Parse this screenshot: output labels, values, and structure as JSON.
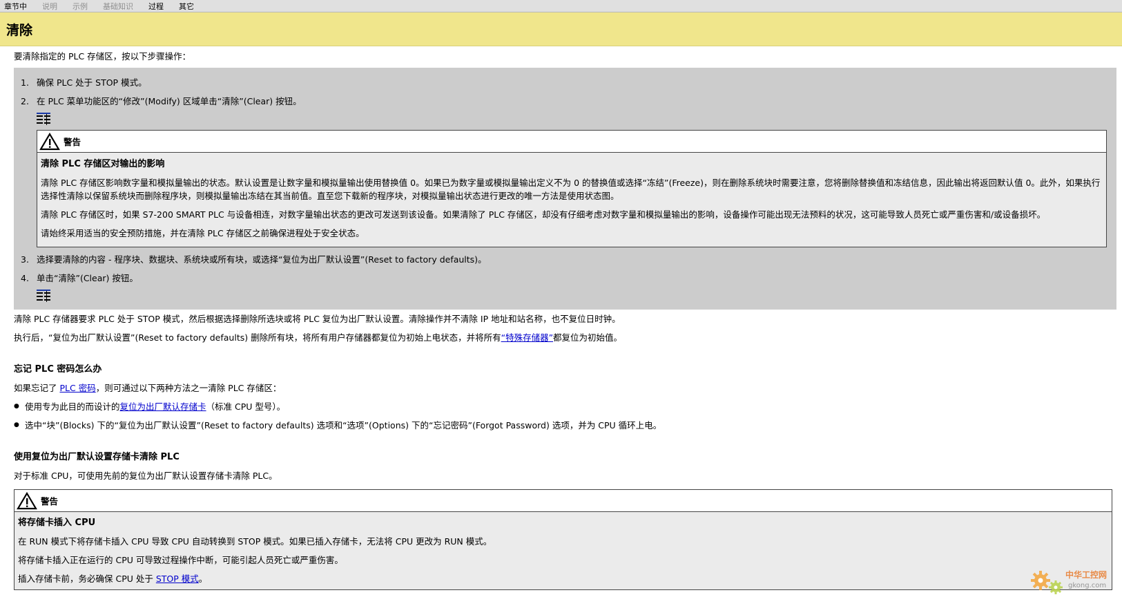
{
  "nav": {
    "tabs": [
      "章节中",
      "说明",
      "示例",
      "基础知识",
      "过程",
      "其它"
    ]
  },
  "page": {
    "title": "清除",
    "intro": "要清除指定的 PLC 存储区，按以下步骤操作："
  },
  "procedure": {
    "step1": {
      "num": "1.",
      "text": "确保 PLC 处于 STOP 模式。"
    },
    "step2": {
      "num": "2.",
      "text": "在 PLC 菜单功能区的“修改”(Modify) 区域单击“清除”(Clear) 按钮。"
    },
    "warning": {
      "label": "警告",
      "title": "清除 PLC 存储区对输出的影响",
      "paragraphs": [
        "清除 PLC 存储区影响数字量和模拟量输出的状态。默认设置是让数字量和模拟量输出使用替换值 0。如果已为数字量或模拟量输出定义不为 0 的替换值或选择“冻结”(Freeze)，则在删除系统块时需要注意，您将删除替换值和冻结信息，因此输出将返回默认值 0。此外，如果执行选择性清除以保留系统块而删除程序块，则模拟量输出冻结在其当前值。直至您下载新的程序块，对模拟量输出状态进行更改的唯一方法是使用状态图。",
        "清除 PLC 存储区时，如果 S7-200 SMART PLC 与设备相连，对数字量输出状态的更改可发送到该设备。如果清除了 PLC 存储区，却没有仔细考虑对数字量和模拟量输出的影响，设备操作可能出现无法预料的状况，这可能导致人员死亡或严重伤害和/或设备损坏。",
        "请始终采用适当的安全预防措施，并在清除 PLC 存储区之前确保进程处于安全状态。"
      ]
    },
    "step3": {
      "num": "3.",
      "text": "选择要清除的内容 - 程序块、数据块、系统块或所有块，或选择“复位为出厂默认设置”(Reset to factory defaults)。"
    },
    "step4": {
      "num": "4.",
      "text": "单击“清除”(Clear) 按钮。"
    }
  },
  "after": {
    "p1": "清除 PLC 存储器要求 PLC 处于 STOP 模式，然后根据选择删除所选块或将 PLC 复位为出厂默认设置。清除操作并不清除 IP 地址和站名称，也不复位日时钟。",
    "p2_before": "执行后，“复位为出厂默认设置”(Reset to factory defaults) 删除所有块，将所有用户存储器都复位为初始上电状态，并将所有",
    "p2_link": "“特殊存储器”",
    "p2_after": "都复位为初始值。"
  },
  "forgot": {
    "heading": "忘记 PLC 密码怎么办",
    "intro_before": "如果忘记了 ",
    "intro_link": "PLC 密码",
    "intro_after": "，则可通过以下两种方法之一清除 PLC 存储区：",
    "b1_before": "使用专为此目的而设计的",
    "b1_link": "复位为出厂默认存储卡",
    "b1_after": "（标准 CPU 型号）。",
    "b2": "选中“块”(Blocks) 下的“复位为出厂默认设置”(Reset to factory defaults) 选项和“选项”(Options) 下的“忘记密码”(Forgot Password) 选项，并为 CPU 循环上电。"
  },
  "card": {
    "heading": "使用复位为出厂默认设置存储卡清除 PLC",
    "intro": "对于标准 CPU，可使用先前的复位为出厂默认设置存储卡清除 PLC。",
    "warning": {
      "label": "警告",
      "title": "将存储卡插入 CPU",
      "p1": "在 RUN 模式下将存储卡插入 CPU 导致 CPU 自动转换到 STOP 模式。如果已插入存储卡，无法将 CPU 更改为 RUN 模式。",
      "p2": "将存储卡插入正在运行的 CPU 可导致过程操作中断，可能引起人员死亡或严重伤害。",
      "p3_before": "插入存储卡前，务必确保 CPU 处于 ",
      "p3_link": "STOP 模式",
      "p3_after": "。"
    }
  },
  "watermark": {
    "text": "中华工控网",
    "url": "gkong.com"
  }
}
